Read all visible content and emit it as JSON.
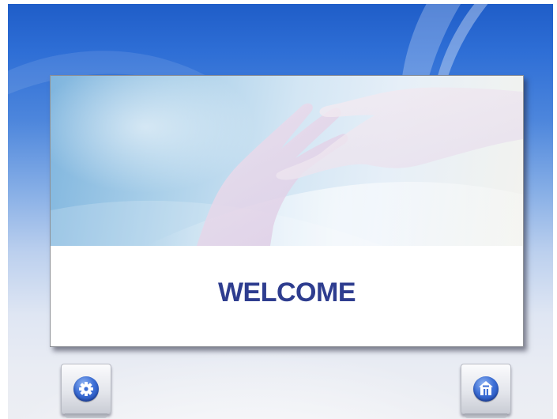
{
  "welcome": {
    "title": "WELCOME"
  },
  "toolbar": {
    "left_icon": "gear-icon",
    "right_icon": "home-icon"
  },
  "colors": {
    "background_top": "#1f5dc8",
    "background_bottom": "#eceef3",
    "title_text": "#2e3d8f",
    "icon_orb": "#3d6fd6"
  }
}
